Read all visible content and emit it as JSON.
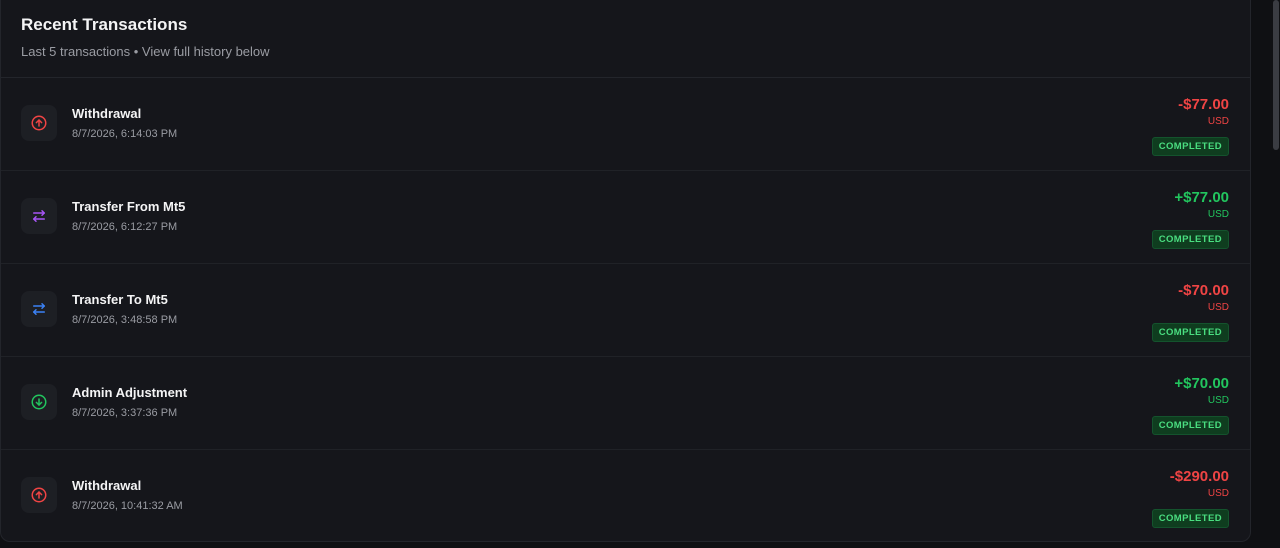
{
  "header": {
    "title": "Recent Transactions",
    "subtitle": "Last 5 transactions • View full history below"
  },
  "colors": {
    "negative": "#ef4444",
    "positive": "#22c55e",
    "transfer_from": "#a855f7",
    "transfer_to": "#3b82f6",
    "badge_bg": "#0f3d1f",
    "badge_text": "#4ade80"
  },
  "transactions": [
    {
      "title": "Withdrawal",
      "date": "8/7/2026, 6:14:03 PM",
      "amount": "-$77.00",
      "currency": "USD",
      "status": "COMPLETED",
      "icon": "arrow-up-circle-icon",
      "sign": "negative"
    },
    {
      "title": "Transfer From Mt5",
      "date": "8/7/2026, 6:12:27 PM",
      "amount": "+$77.00",
      "currency": "USD",
      "status": "COMPLETED",
      "icon": "transfer-arrows-icon",
      "sign": "positive"
    },
    {
      "title": "Transfer To Mt5",
      "date": "8/7/2026, 3:48:58 PM",
      "amount": "-$70.00",
      "currency": "USD",
      "status": "COMPLETED",
      "icon": "transfer-arrows-icon",
      "sign": "negative"
    },
    {
      "title": "Admin Adjustment",
      "date": "8/7/2026, 3:37:36 PM",
      "amount": "+$70.00",
      "currency": "USD",
      "status": "COMPLETED",
      "icon": "arrow-down-circle-icon",
      "sign": "positive"
    },
    {
      "title": "Withdrawal",
      "date": "8/7/2026, 10:41:32 AM",
      "amount": "-$290.00",
      "currency": "USD",
      "status": "COMPLETED",
      "icon": "arrow-up-circle-icon",
      "sign": "negative"
    }
  ]
}
